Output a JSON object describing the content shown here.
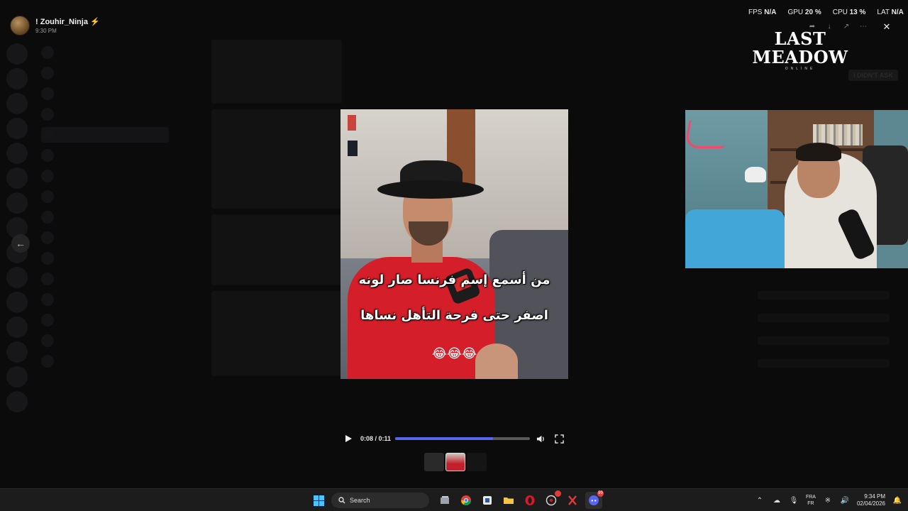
{
  "viewer": {
    "sender_name": "! Zouhir_Ninja ⚡",
    "sent_time": "9:30 PM"
  },
  "media": {
    "caption_line1": "من أسمع إسم فرنسا صار لونه",
    "caption_line2": "اصفر حتى فرحة التأهل نساها",
    "caption_emojis": "😂😂😂",
    "time_display": "0:08 / 0:11",
    "progress": 0.727
  },
  "hud": {
    "fps_label": "FPS",
    "fps_value": "N/A",
    "gpu_label": "GPU",
    "gpu_value": "20 %",
    "cpu_label": "CPU",
    "cpu_value": "13 %",
    "lat_label": "LAT",
    "lat_value": "N/A"
  },
  "game_logo": {
    "title": "LAST MEADOW",
    "subtitle": "ONLINE"
  },
  "overlay_button": "I DIDN'T ASK",
  "taskbar": {
    "search_label": "Search",
    "discord_badge": "99",
    "lang_line1": "FRA",
    "lang_line2": "FR",
    "time": "9:34 PM",
    "date": "02/04/2026"
  },
  "colors": {
    "accent": "#5865f2",
    "windows_blue": "#4cc2ff",
    "caption_bg": "#d41f2a"
  },
  "icons": [
    "back-arrow-icon",
    "play-icon",
    "volume-icon",
    "fullscreen-icon",
    "close-icon",
    "forward-icon",
    "download-icon",
    "external-link-icon",
    "more-icon",
    "windows-logo-icon",
    "search-icon",
    "chevron-up-icon",
    "wifi-icon",
    "volume-tray-icon",
    "notification-icon"
  ]
}
